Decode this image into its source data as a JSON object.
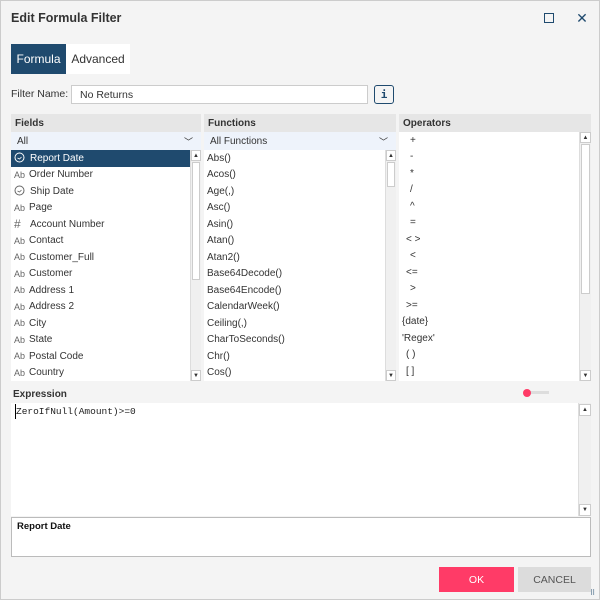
{
  "dialog": {
    "title": "Edit Formula Filter"
  },
  "tabs": [
    {
      "label": "Formula"
    },
    {
      "label": "Advanced"
    }
  ],
  "filter_name": {
    "label": "Filter Name:",
    "value": "No Returns",
    "info": "i"
  },
  "fields": {
    "header": "Fields",
    "dropdown": "All",
    "items": [
      {
        "icon": "clock",
        "label": "Report Date"
      },
      {
        "icon": "Ab",
        "label": "Order Number"
      },
      {
        "icon": "clock",
        "label": "Ship Date"
      },
      {
        "icon": "Ab",
        "label": "Page"
      },
      {
        "icon": "#",
        "label": "Account Number"
      },
      {
        "icon": "Ab",
        "label": "Contact"
      },
      {
        "icon": "Ab",
        "label": "Customer_Full"
      },
      {
        "icon": "Ab",
        "label": "Customer"
      },
      {
        "icon": "Ab",
        "label": "Address 1"
      },
      {
        "icon": "Ab",
        "label": "Address 2"
      },
      {
        "icon": "Ab",
        "label": "City"
      },
      {
        "icon": "Ab",
        "label": "State"
      },
      {
        "icon": "Ab",
        "label": "Postal Code"
      },
      {
        "icon": "Ab",
        "label": "Country"
      }
    ]
  },
  "functions": {
    "header": "Functions",
    "dropdown": "All Functions",
    "items": [
      "Abs()",
      "Acos()",
      "Age(,)",
      "Asc()",
      "Asin()",
      "Atan()",
      "Atan2()",
      "Base64Decode()",
      "Base64Encode()",
      "CalendarWeek()",
      "Ceiling(,)",
      "CharToSeconds()",
      "Chr()",
      "Cos()"
    ]
  },
  "operators": {
    "header": "Operators",
    "items": [
      "+",
      "-",
      "*",
      "/",
      "^",
      "=",
      "< >",
      "<",
      "<=",
      ">",
      ">=",
      "{date}",
      "'Regex'",
      "( )",
      "[ ]"
    ]
  },
  "expression": {
    "label": "Expression",
    "value": "ZeroIfNull(Amount)>=0",
    "slider_value": 0
  },
  "description": {
    "title": "Report Date"
  },
  "buttons": {
    "ok": "OK",
    "cancel": "CANCEL"
  },
  "colors": {
    "primary": "#1f4a6e",
    "accent": "#ff3b67"
  }
}
